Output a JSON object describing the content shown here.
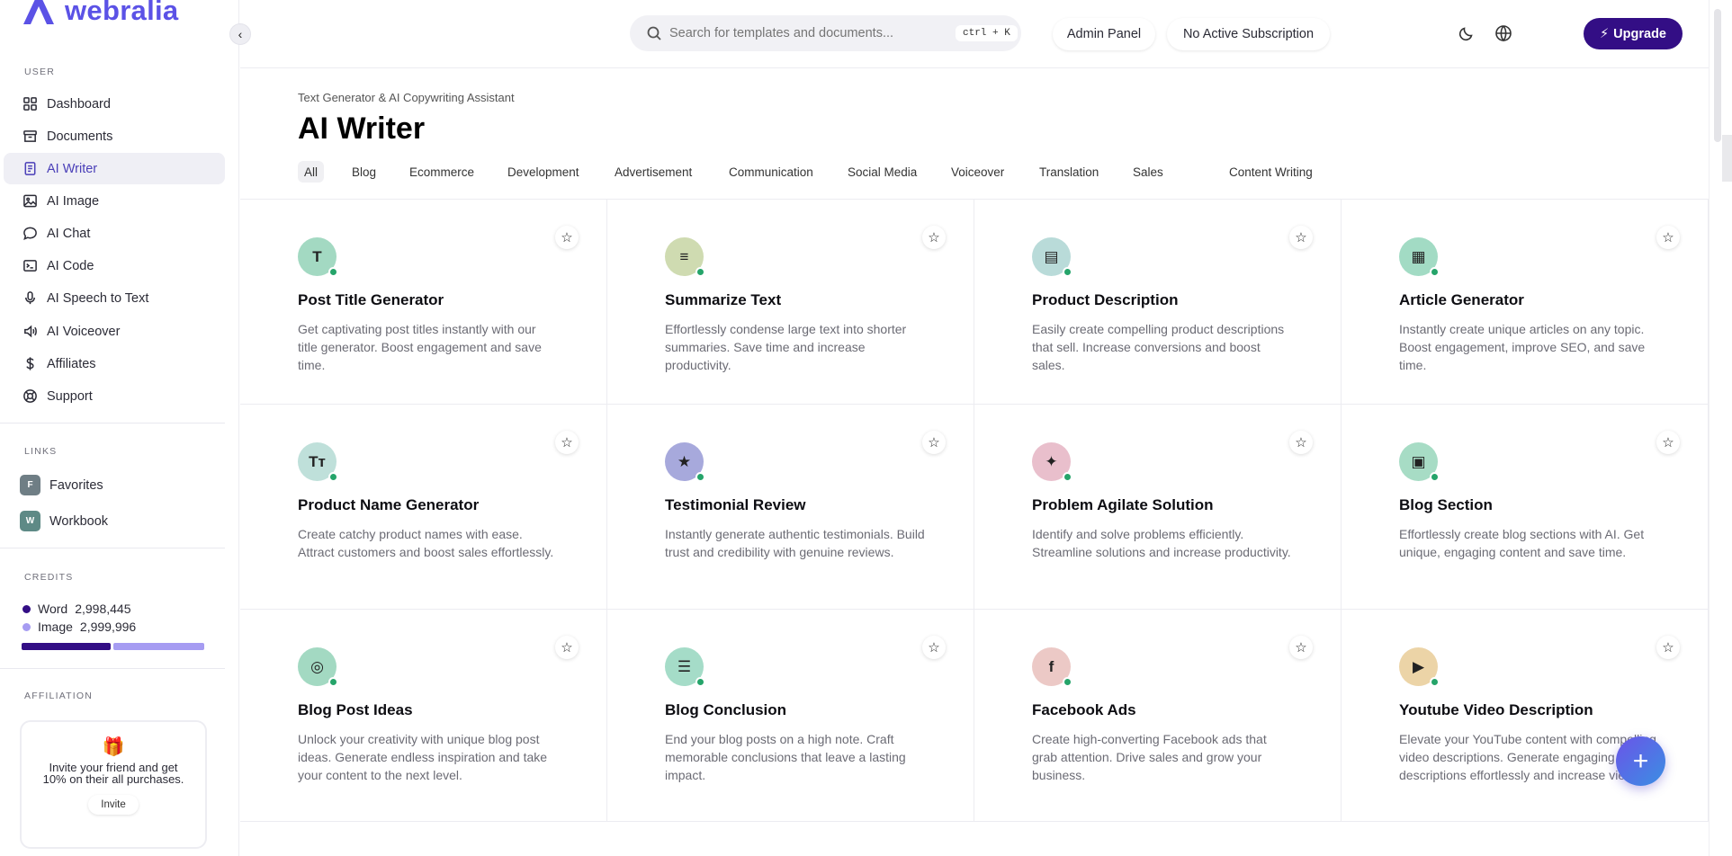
{
  "brand": {
    "name": "webralia"
  },
  "sidebar": {
    "user_label": "USER",
    "items": [
      {
        "label": "Dashboard",
        "icon": "dashboard-icon"
      },
      {
        "label": "Documents",
        "icon": "archive-icon"
      },
      {
        "label": "AI Writer",
        "icon": "document-icon",
        "active": true
      },
      {
        "label": "AI Image",
        "icon": "image-icon"
      },
      {
        "label": "AI Chat",
        "icon": "chat-icon"
      },
      {
        "label": "AI Code",
        "icon": "terminal-icon"
      },
      {
        "label": "AI Speech to Text",
        "icon": "microphone-icon"
      },
      {
        "label": "AI Voiceover",
        "icon": "speaker-icon"
      },
      {
        "label": "Affiliates",
        "icon": "dollar-icon"
      },
      {
        "label": "Support",
        "icon": "lifebuoy-icon"
      }
    ],
    "links_label": "LINKS",
    "links": [
      {
        "badge": "F",
        "label": "Favorites",
        "color": "#6f7e85"
      },
      {
        "badge": "W",
        "label": "Workbook",
        "color": "#5e8a86"
      }
    ],
    "credits_label": "CREDITS",
    "credits": [
      {
        "label": "Word",
        "value": "2,998,445",
        "color": "#330e85"
      },
      {
        "label": "Image",
        "value": "2,999,996",
        "color": "#a69cf2"
      }
    ],
    "affiliation_label": "AFFILIATION",
    "invite": {
      "text": "Invite your friend and get 10% on their all purchases.",
      "button": "Invite"
    }
  },
  "header": {
    "search_placeholder": "Search for templates and documents...",
    "shortcut": "ctrl + K",
    "admin_panel": "Admin Panel",
    "subscription": "No Active Subscription",
    "upgrade": "Upgrade"
  },
  "page": {
    "subtitle": "Text Generator & AI Copywriting Assistant",
    "title": "AI Writer",
    "tabs": [
      "All",
      "Blog",
      "Ecommerce",
      "Development",
      "Advertisement",
      "Communication",
      "Social Media",
      "Voiceover",
      "Translation",
      "Sales",
      "Content Writing"
    ]
  },
  "cards": [
    {
      "title": "Post Title Generator",
      "desc": "Get captivating post titles instantly with our title generator. Boost engagement and save time.",
      "icon": "T",
      "icon_name": "text-t-icon",
      "bg": "#a3d9c2"
    },
    {
      "title": "Summarize Text",
      "desc": "Effortlessly condense large text into shorter summaries. Save time and increase productivity.",
      "icon": "≡",
      "icon_name": "align-lines-icon",
      "bg": "#cfdbb1"
    },
    {
      "title": "Product Description",
      "desc": "Easily create compelling product descriptions that sell. Increase conversions and boost sales.",
      "icon": "▤",
      "icon_name": "file-icon",
      "bg": "#b9dbd9"
    },
    {
      "title": "Article Generator",
      "desc": "Instantly create unique articles on any topic. Boost engagement, improve SEO, and save time.",
      "icon": "▦",
      "icon_name": "article-icon",
      "bg": "#a2dbc4"
    },
    {
      "title": "Product Name Generator",
      "desc": "Create catchy product names with ease. Attract customers and boost sales effortlessly.",
      "icon": "Tт",
      "icon_name": "text-size-icon",
      "bg": "#bfe0da"
    },
    {
      "title": "Testimonial Review",
      "desc": "Instantly generate authentic testimonials. Build trust and credibility with genuine reviews.",
      "icon": "★",
      "icon_name": "star-icon",
      "bg": "#a7a9dc"
    },
    {
      "title": "Problem Agilate Solution",
      "desc": "Identify and solve problems efficiently. Streamline solutions and increase productivity.",
      "icon": "✦",
      "icon_name": "sparkles-icon",
      "bg": "#e9bfcc"
    },
    {
      "title": "Blog Section",
      "desc": "Effortlessly create blog sections with AI. Get unique, engaging content and save time.",
      "icon": "▣",
      "icon_name": "blog-icon",
      "bg": "#a7dcc5"
    },
    {
      "title": "Blog Post Ideas",
      "desc": "Unlock your creativity with unique blog post ideas. Generate endless inspiration and take your content to the next level.",
      "icon": "◎",
      "icon_name": "idea-icon",
      "bg": "#a3d9c2"
    },
    {
      "title": "Blog Conclusion",
      "desc": "End your blog posts on a high note. Craft memorable conclusions that leave a lasting impact.",
      "icon": "☰",
      "icon_name": "filter-lines-icon",
      "bg": "#a5dcc8"
    },
    {
      "title": "Facebook Ads",
      "desc": "Create high-converting Facebook ads that grab attention. Drive sales and grow your business.",
      "icon": "f",
      "icon_name": "facebook-icon",
      "bg": "#ecc9c6"
    },
    {
      "title": "Youtube Video Description",
      "desc": "Elevate your YouTube content with compelling video descriptions. Generate engaging descriptions effortlessly and increase views.",
      "icon": "▶",
      "icon_name": "youtube-icon",
      "bg": "#ecd4a7"
    }
  ],
  "fab": {
    "label": "+"
  }
}
